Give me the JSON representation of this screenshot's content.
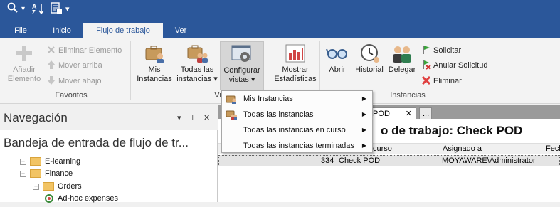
{
  "quick_access": {
    "items": [
      {
        "name": "search-icon",
        "glyph": "⚲"
      },
      {
        "name": "dropdown-arrow",
        "glyph": "▾"
      },
      {
        "name": "sort-az-icon",
        "glyph": "A↓Z"
      },
      {
        "name": "export-icon",
        "glyph": "▤"
      },
      {
        "name": "qat-customize",
        "glyph": "≡"
      }
    ]
  },
  "tabs": [
    "File",
    "Inicio",
    "Flujo de trabajo",
    "Ver"
  ],
  "active_tab": "Flujo de trabajo",
  "ribbon": {
    "favoritos": {
      "label": "Favoritos",
      "add": "Añadir\nElemento",
      "add_line1": "Añadir",
      "add_line2": "Elemento",
      "remove": "Eliminar Elemento",
      "move_up": "Mover arriba",
      "move_down": "Mover abajo"
    },
    "vistas": {
      "label": "Vi",
      "mis_l1": "Mis",
      "mis_l2": "Instancias",
      "todas_l1": "Todas las",
      "todas_l2": "instancias",
      "config_l1": "Configurar",
      "config_l2": "vistas",
      "stats_l1": "Mostrar",
      "stats_l2": "Estadísticas"
    },
    "instancias": {
      "label": "Instancias",
      "abrir": "Abrir",
      "historial": "Historial",
      "delegar": "Delegar",
      "solicitar": "Solicitar",
      "anular": "Anular Solicitud",
      "eliminar": "Eliminar"
    }
  },
  "dropdown_menu": {
    "items": [
      "Mis Instancias",
      "Todas las instancias",
      "Todas las instancias en curso",
      "Todas las instancias terminadas"
    ]
  },
  "navigation": {
    "title": "Navegación",
    "inbox_title": "Bandeja de entrada de flujo de tr...",
    "tree": [
      {
        "label": "E-learning",
        "level": 1,
        "expander": "+"
      },
      {
        "label": "Finance",
        "level": 1,
        "expander": "−"
      },
      {
        "label": "Orders",
        "level": 2,
        "expander": "+"
      },
      {
        "label": "Ad-hoc expenses",
        "level": 2,
        "expander": ""
      }
    ]
  },
  "document": {
    "tab_label": "ck POD",
    "tab_more": "...",
    "title": "o de trabajo: Check POD",
    "columns": [
      "curso",
      "Asignado a",
      "Fech"
    ],
    "row": {
      "id": "334",
      "name": "Check POD",
      "assigned": "MOYAWARE\\Administrator"
    }
  },
  "colors": {
    "accent": "#2b579a",
    "ribbon_bg": "#f3f3f3",
    "delete_red": "#e04040"
  }
}
